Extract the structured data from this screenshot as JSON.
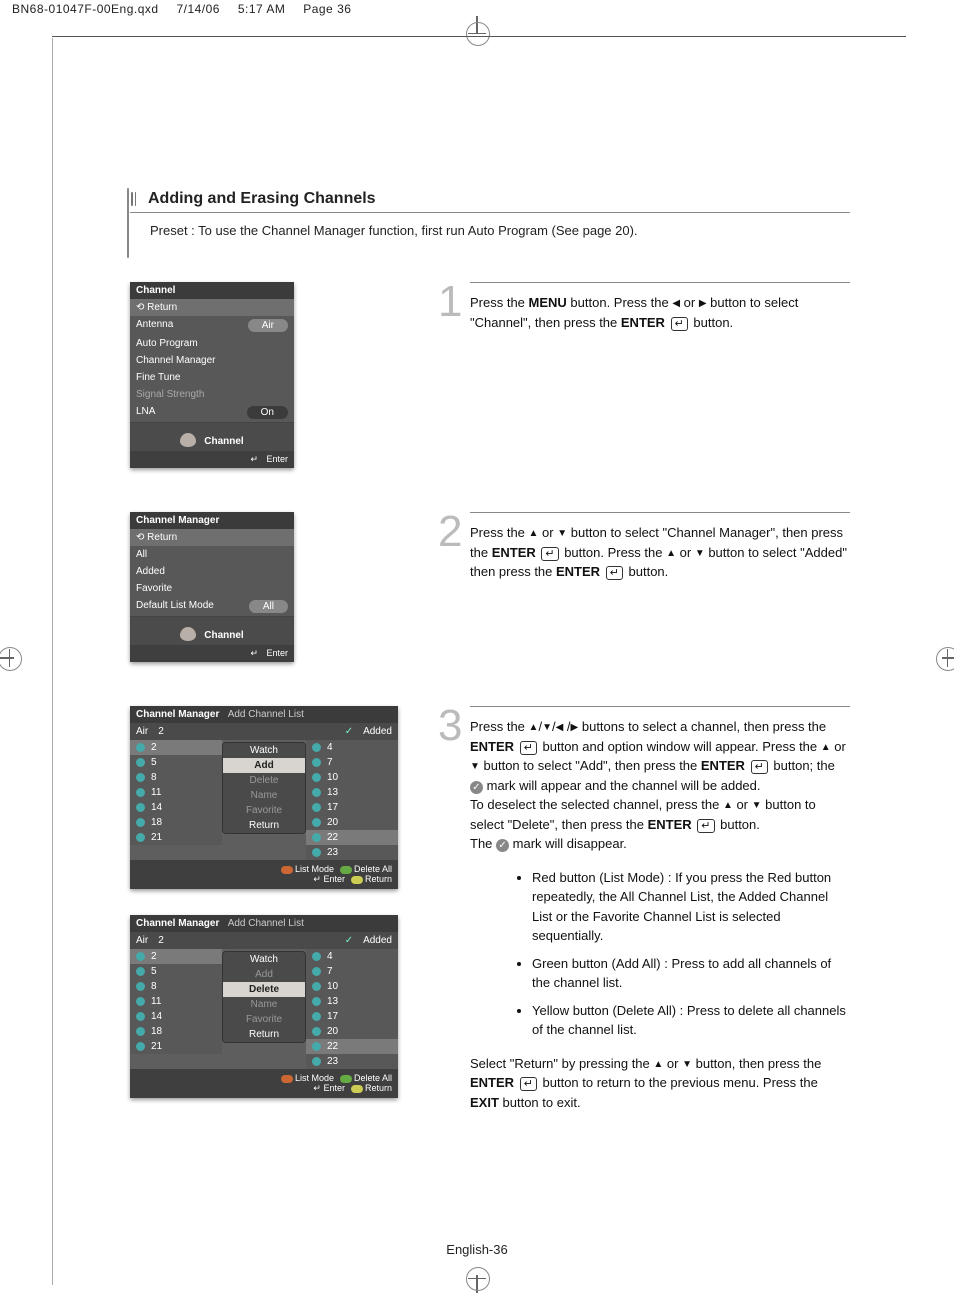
{
  "meta": {
    "filename": "BN68-01047F-00Eng.qxd",
    "date": "7/14/06",
    "time": "5:17 AM",
    "page": "Page 36"
  },
  "section": {
    "title": "Adding and Erasing Channels",
    "preset": "Preset : To use the Channel Manager function, first run Auto Program (See page 20)."
  },
  "osd1": {
    "title": "Channel",
    "return": "Return",
    "items": [
      {
        "label": "Antenna",
        "value": "Air"
      },
      {
        "label": "Auto Program"
      },
      {
        "label": "Channel Manager"
      },
      {
        "label": "Fine Tune"
      },
      {
        "label": "Signal Strength",
        "dim": true
      },
      {
        "label": "LNA",
        "value": "On"
      }
    ],
    "brand": "Channel",
    "enter": "Enter"
  },
  "osd2": {
    "title": "Channel Manager",
    "return": "Return",
    "items": [
      {
        "label": "All"
      },
      {
        "label": "Added"
      },
      {
        "label": "Favorite"
      },
      {
        "label": "Default List Mode",
        "value": "All"
      }
    ],
    "brand": "Channel",
    "enter": "Enter"
  },
  "osd3": {
    "title": "Channel Manager",
    "crumb": "Add Channel List",
    "headers": {
      "air": "Air",
      "num": "2",
      "added": "Added"
    },
    "left": [
      "2",
      "5",
      "8",
      "11",
      "14",
      "18",
      "21"
    ],
    "right": [
      "4",
      "7",
      "10",
      "13",
      "17",
      "20",
      "23"
    ],
    "selLeft": "2",
    "selRight": "22",
    "popup": [
      "Watch",
      "Add",
      "Delete",
      "Name",
      "Favorite",
      "Return"
    ],
    "popupHiIndex": 1,
    "foot": {
      "list": "List Mode",
      "del": "Delete All",
      "enter": "Enter",
      "ret": "Return"
    }
  },
  "osd4": {
    "title": "Channel Manager",
    "crumb": "Add Channel List",
    "headers": {
      "air": "Air",
      "num": "2",
      "added": "Added"
    },
    "left": [
      "2",
      "5",
      "8",
      "11",
      "14",
      "18",
      "21"
    ],
    "right": [
      "4",
      "7",
      "10",
      "13",
      "17",
      "20",
      "23"
    ],
    "selLeft": "2",
    "selRight": "22",
    "popup": [
      "Watch",
      "Add",
      "Delete",
      "Name",
      "Favorite",
      "Return"
    ],
    "popupHiIndex": 2,
    "foot": {
      "list": "List Mode",
      "del": "Delete All",
      "enter": "Enter",
      "ret": "Return"
    }
  },
  "steps": {
    "s1": {
      "num": "1",
      "a": "Press the ",
      "menu": "MENU",
      "b": " button. Press the ",
      "c": " or ",
      "d": " button to select \"Channel\", then press the ",
      "enter": "ENTER",
      "e": " button."
    },
    "s2": {
      "num": "2",
      "a": "Press the ",
      "b": " or ",
      "c": " button to select \"Channel Manager\", then press the ",
      "enter": "ENTER",
      "d": " button. Press the ",
      "e": " or ",
      "f": " button to select \"Added\" then press the ",
      "g": " button."
    },
    "s3": {
      "num": "3",
      "p1a": "Press the ",
      "p1b": " buttons to select a channel, then press the ",
      "enter": "ENTER",
      "p1c": " button and option window will appear. Press the ",
      "p1d": " or ",
      "p1e": " button to select \"Add\", then press the ",
      "p1f": " button; the ",
      "p1g": " mark  will appear and the channel will be added.",
      "p2a": "To deselect the selected channel, press the ",
      "p2b": " or ",
      "p2c": " button to select \"Delete\", then press the ",
      "p2d": " button.",
      "p2e": "The ",
      "p2f": " mark will disappear.",
      "b1": "Red button (List Mode) : If you press the Red button repeatedly, the All Channel List, the Added Channel List or the Favorite Channel List is selected  sequentially.",
      "b2": "Green button (Add All) : Press to add all channels of the channel list.",
      "b3": "Yellow button (Delete All) : Press to delete all channels of the channel list.",
      "p3a": "Select \"Return\" by pressing the ",
      "p3b": " or ",
      "p3c": " button, then press the ",
      "p3d": " button to return to the previous menu. Press the ",
      "exit": "EXIT",
      "p3e": " button to exit."
    }
  },
  "pagenum": "English-36"
}
